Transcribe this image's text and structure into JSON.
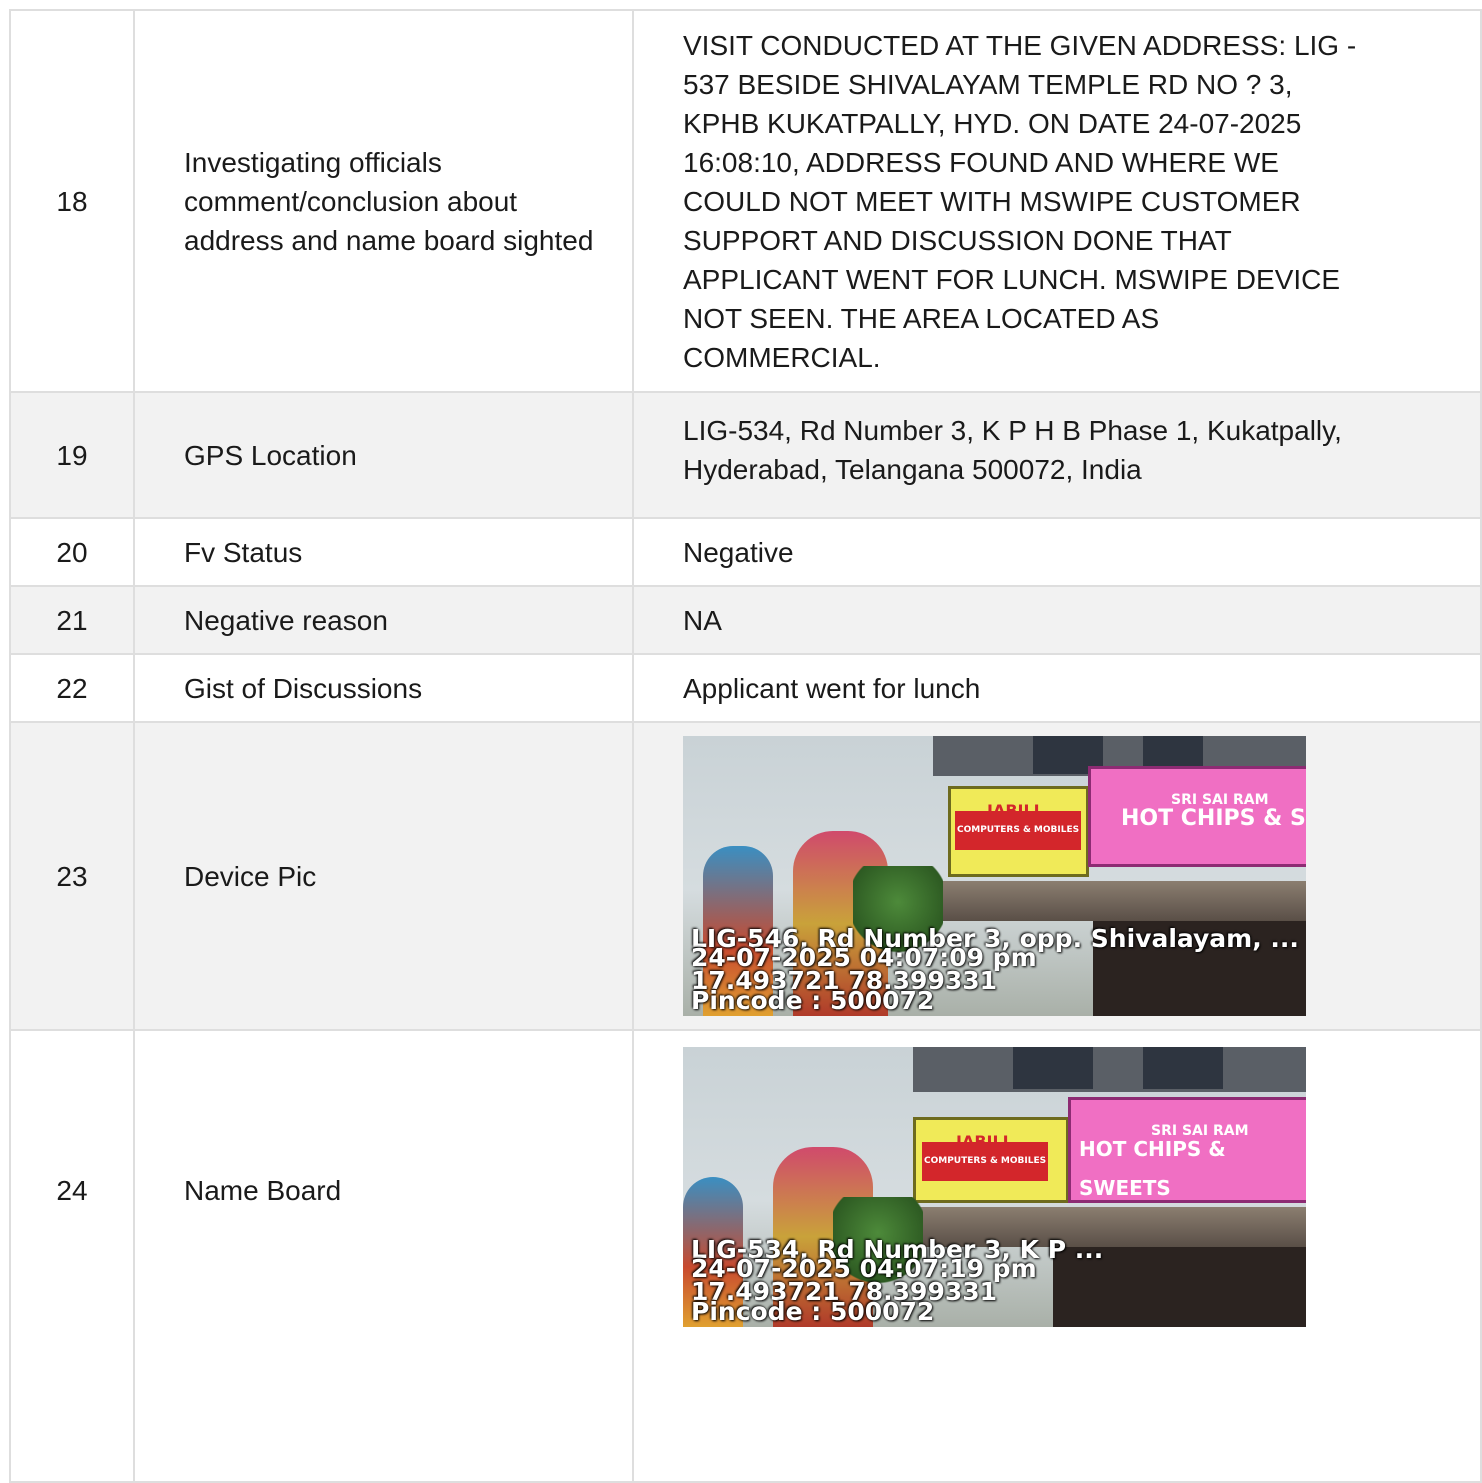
{
  "rows": [
    {
      "no": "18",
      "label": "Investigating officials comment/conclusion about address and name board sighted",
      "value": "VISIT CONDUCTED AT THE GIVEN ADDRESS: LIG -\n537 BESIDE SHIVALAYAM TEMPLE RD NO ? 3,\nKPHB KUKATPALLY, HYD. ON DATE 24-07-2025\n16:08:10, ADDRESS FOUND AND WHERE WE\nCOULD NOT MEET WITH MSWIPE CUSTOMER\nSUPPORT AND DISCUSSION DONE THAT\nAPPLICANT WENT FOR LUNCH. MSWIPE DEVICE\nNOT SEEN. THE AREA LOCATED AS\nCOMMERCIAL."
    },
    {
      "no": "19",
      "label": "GPS Location",
      "value": "LIG-534, Rd Number 3, K P H B Phase 1, Kukatpally,\nHyderabad, Telangana 500072, India"
    },
    {
      "no": "20",
      "label": "Fv Status",
      "value": "Negative"
    },
    {
      "no": "21",
      "label": "Negative reason",
      "value": "NA"
    },
    {
      "no": "22",
      "label": "Gist of Discussions",
      "value": "Applicant went for lunch"
    },
    {
      "no": "23",
      "label": "Device Pic",
      "photo": {
        "line1": "LIG-546, Rd Number 3, opp. Shivalayam, ...",
        "line2": "24-07-2025 04:07:09 pm",
        "line3": "17.493721 78.399331",
        "line4": "Pincode : 500072",
        "board1": "JABILI",
        "board1_sub": "COMPUTERS & MOBILES",
        "board2_top": "SRI SAI RAM",
        "board2": "HOT CHIPS & S"
      }
    },
    {
      "no": "24",
      "label": "Name Board",
      "photo": {
        "line1": "LIG-534, Rd Number 3, K P ...",
        "line2": "24-07-2025 04:07:19 pm",
        "line3": "17.493721 78.399331",
        "line4": "Pincode : 500072",
        "board1": "JABILI",
        "board1_sub": "COMPUTERS & MOBILES",
        "board2_top": "SRI SAI RAM",
        "board2": "HOT CHIPS & SWEETS"
      }
    }
  ],
  "colors": {
    "border": "#dedede",
    "shaded_row": "#f2f2f2",
    "board_yellow": "#f0ea58",
    "board_pink": "#f06fc3"
  }
}
